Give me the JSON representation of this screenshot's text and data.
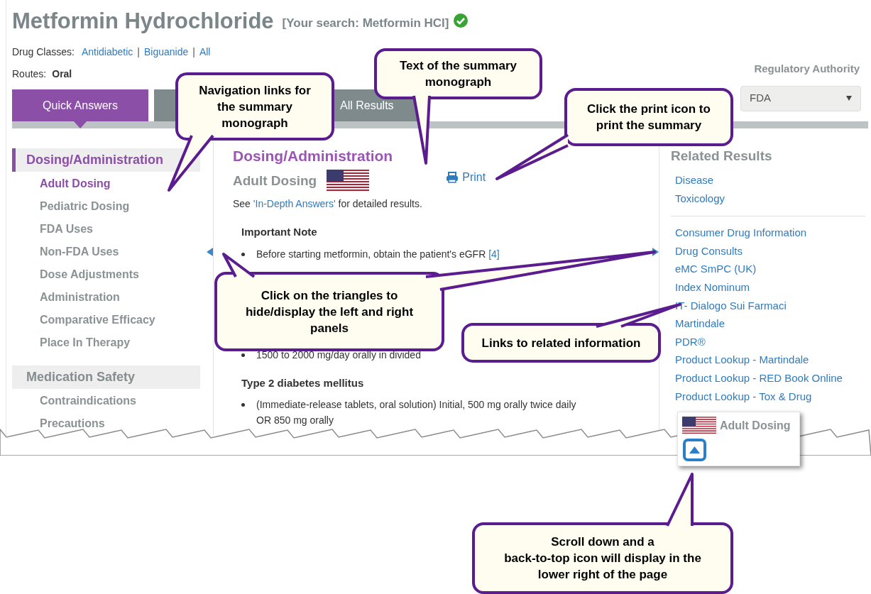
{
  "header": {
    "title": "Metformin Hydrochloride",
    "search_note": "[Your search:  Metformin HCl]",
    "drug_classes_label": "Drug Classes:",
    "drug_classes": [
      {
        "label": "Antidiabetic",
        "separator": "|"
      },
      {
        "label": "Biguanide",
        "separator": "|"
      },
      {
        "label": "All"
      }
    ],
    "routes_label": "Routes:",
    "route": "Oral"
  },
  "regulatory_authority": {
    "label": "Regulatory Authority",
    "value": "FDA"
  },
  "tabs": [
    {
      "label": "Quick Answers",
      "selected": true
    },
    {
      "label": "All Results",
      "selected": false
    }
  ],
  "sidebar": {
    "sections": [
      {
        "title": "Dosing/Administration",
        "selected": true,
        "items": [
          {
            "label": "Adult Dosing",
            "selected": true
          },
          {
            "label": "Pediatric Dosing",
            "selected": false
          },
          {
            "label": "FDA Uses",
            "selected": false
          },
          {
            "label": "Non-FDA Uses",
            "selected": false
          },
          {
            "label": "Dose Adjustments",
            "selected": false
          },
          {
            "label": "Administration",
            "selected": false
          },
          {
            "label": "Comparative Efficacy",
            "selected": false
          },
          {
            "label": "Place In Therapy",
            "selected": false
          }
        ]
      },
      {
        "title": "Medication Safety",
        "selected": false,
        "items": [
          {
            "label": "Contraindications",
            "selected": false
          },
          {
            "label": "Precautions",
            "selected": false
          }
        ]
      }
    ]
  },
  "main": {
    "heading": "Dosing/Administration",
    "subheading": "Adult Dosing",
    "print": "Print",
    "see_prefix": "See ",
    "see_link": "'In-Depth Answers'",
    "see_suffix": " for detailed results.",
    "blocks": [
      {
        "title": "Important Note",
        "bullets": [
          {
            "text": "Before starting metformin, obtain the patient's eGFR",
            "ref": "[4]"
          }
        ]
      },
      {
        "bullets": [
          {
            "text": "1500 to 2000 mg/day orally in divided"
          }
        ]
      },
      {
        "title": "Type 2 diabetes mellitus",
        "bullets": [
          {
            "text": "(Immediate-release tablets, oral solution) Initial, 500 mg orally twice daily OR 850 mg orally"
          }
        ]
      }
    ]
  },
  "related": {
    "title": "Related Results",
    "groups": [
      [
        "Disease",
        "Toxicology"
      ],
      [
        "Consumer Drug Information",
        "Drug Consults",
        "eMC SmPC (UK)",
        "Index Nominum",
        "IT- Dialogo Sui Farmaci",
        "Martindale",
        "PDR®",
        "Product Lookup - Martindale",
        "Product Lookup - RED Book Online",
        "Product Lookup - Tox & Drug"
      ]
    ]
  },
  "back_to_top": {
    "label": "Adult Dosing"
  },
  "callouts": [
    {
      "lines": [
        "Navigation links for",
        "the summary",
        "monograph"
      ]
    },
    {
      "lines": [
        "Text of the summary",
        "monograph"
      ]
    },
    {
      "lines": [
        "Click the print icon to",
        "print the summary"
      ]
    },
    {
      "lines": [
        "Click on the triangles to",
        "hide/display the left and right",
        "panels"
      ]
    },
    {
      "lines": [
        "Links to related information"
      ]
    },
    {
      "lines": [
        "Scroll down and a",
        "back-to-top icon will display in the",
        "lower right of the page"
      ]
    }
  ]
}
